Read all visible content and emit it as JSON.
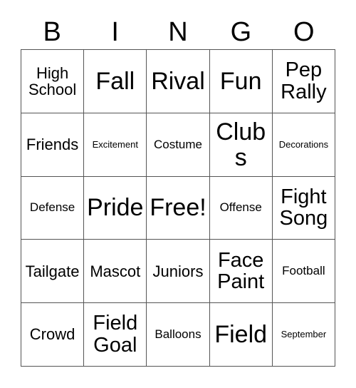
{
  "card": {
    "type": "bingo-card",
    "header_letters": [
      "B",
      "I",
      "N",
      "G",
      "O"
    ],
    "columns": 5,
    "rows": 5,
    "colors": {
      "background": "#ffffff",
      "text": "#000000",
      "grid_line": "#555555"
    },
    "free_space": "Free!",
    "cells": [
      [
        {
          "label": "High School",
          "size": "m"
        },
        {
          "label": "Fall",
          "size": "xl"
        },
        {
          "label": "Rival",
          "size": "xl"
        },
        {
          "label": "Fun",
          "size": "xl"
        },
        {
          "label": "Pep Rally",
          "size": "l"
        }
      ],
      [
        {
          "label": "Friends",
          "size": "m"
        },
        {
          "label": "Excitement",
          "size": "xs"
        },
        {
          "label": "Costume",
          "size": "s"
        },
        {
          "label": "Clubs",
          "size": "xl"
        },
        {
          "label": "Decorations",
          "size": "xs"
        }
      ],
      [
        {
          "label": "Defense",
          "size": "s"
        },
        {
          "label": "Pride",
          "size": "xl"
        },
        {
          "label": "Free!",
          "size": "xl"
        },
        {
          "label": "Offense",
          "size": "s"
        },
        {
          "label": "Fight Song",
          "size": "l"
        }
      ],
      [
        {
          "label": "Tailgate",
          "size": "m"
        },
        {
          "label": "Mascot",
          "size": "m"
        },
        {
          "label": "Juniors",
          "size": "m"
        },
        {
          "label": "Face Paint",
          "size": "l"
        },
        {
          "label": "Football",
          "size": "s"
        }
      ],
      [
        {
          "label": "Crowd",
          "size": "m"
        },
        {
          "label": "Field Goal",
          "size": "l"
        },
        {
          "label": "Balloons",
          "size": "s"
        },
        {
          "label": "Field",
          "size": "xl"
        },
        {
          "label": "September",
          "size": "xs"
        }
      ]
    ]
  }
}
